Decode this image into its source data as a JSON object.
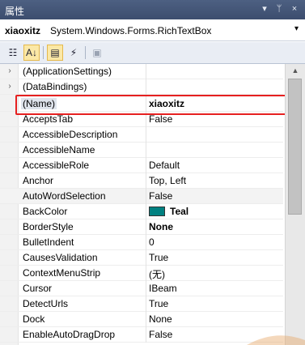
{
  "titlebar": {
    "title": "属性",
    "dropdown_icon": "▾",
    "pin_icon": "ᛘ",
    "close_icon": "×"
  },
  "object_selector": {
    "name": "xiaoxitz",
    "type": "System.Windows.Forms.RichTextBox",
    "dropdown_icon": "▾"
  },
  "toolbar": {
    "categorized_icon": "☷",
    "alphabetical_icon": "A↓",
    "properties_icon": "▤",
    "events_icon": "⚡",
    "property_pages_icon": "▣"
  },
  "properties": [
    {
      "expander": "›",
      "name": "(ApplicationSettings)",
      "value": ""
    },
    {
      "expander": "›",
      "name": "(DataBindings)",
      "value": ""
    },
    {
      "expander": "",
      "name": "(Name)",
      "value": "xiaoxitz"
    },
    {
      "expander": "",
      "name": "AcceptsTab",
      "value": "False"
    },
    {
      "expander": "",
      "name": "AccessibleDescription",
      "value": ""
    },
    {
      "expander": "",
      "name": "AccessibleName",
      "value": ""
    },
    {
      "expander": "",
      "name": "AccessibleRole",
      "value": "Default"
    },
    {
      "expander": "",
      "name": "Anchor",
      "value": "Top, Left"
    },
    {
      "expander": "",
      "name": "AutoWordSelection",
      "value": "False"
    },
    {
      "expander": "",
      "name": "BackColor",
      "value": "Teal",
      "swatch_color": "#008080"
    },
    {
      "expander": "",
      "name": "BorderStyle",
      "value": "None"
    },
    {
      "expander": "",
      "name": "BulletIndent",
      "value": "0"
    },
    {
      "expander": "",
      "name": "CausesValidation",
      "value": "True"
    },
    {
      "expander": "",
      "name": "ContextMenuStrip",
      "value": "(无)"
    },
    {
      "expander": "",
      "name": "Cursor",
      "value": "IBeam"
    },
    {
      "expander": "",
      "name": "DetectUrls",
      "value": "True"
    },
    {
      "expander": "",
      "name": "Dock",
      "value": "None"
    },
    {
      "expander": "",
      "name": "EnableAutoDragDrop",
      "value": "False"
    }
  ],
  "scrollbar": {
    "up_icon": "▲",
    "down_icon": "▼"
  },
  "colors": {
    "titlebar": "#3c4d6e",
    "highlight_border": "#e62020",
    "teal": "#008080"
  }
}
